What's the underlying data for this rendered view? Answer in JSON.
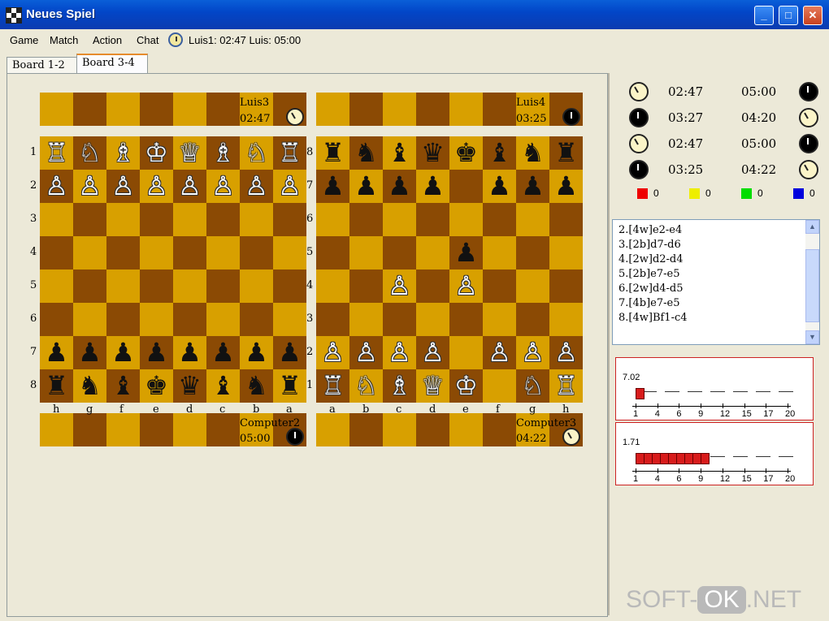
{
  "window": {
    "title": "Neues Spiel"
  },
  "menu": [
    "Game",
    "Match",
    "Action",
    "Chat"
  ],
  "status": {
    "clock_line": "Luis1: 02:47  Luis: 05:00"
  },
  "tabs": [
    "Board 1-2",
    "Board 3-4"
  ],
  "left_board": {
    "top_player": {
      "name": "Luis3",
      "time": "02:47"
    },
    "bottom_player": {
      "name": "Computer2",
      "time": "05:00"
    },
    "rank_labels": [
      "1",
      "2",
      "3",
      "4",
      "5",
      "6",
      "7",
      "8"
    ],
    "file_labels": [
      "h",
      "g",
      "f",
      "e",
      "d",
      "c",
      "b",
      "a"
    ],
    "rows": [
      [
        "wR",
        "wN",
        "wB",
        "wK",
        "wQ",
        "wB",
        "wN",
        "wR"
      ],
      [
        "wP",
        "wP",
        "wP",
        "wP",
        "wP",
        "wP",
        "wP",
        "wP"
      ],
      [
        "",
        "",
        "",
        "",
        "",
        "",
        "",
        ""
      ],
      [
        "",
        "",
        "",
        "",
        "",
        "",
        "",
        ""
      ],
      [
        "",
        "",
        "",
        "",
        "",
        "",
        "",
        ""
      ],
      [
        "",
        "",
        "",
        "",
        "",
        "",
        "",
        ""
      ],
      [
        "bP",
        "bP",
        "bP",
        "bP",
        "bP",
        "bP",
        "bP",
        "bP"
      ],
      [
        "bR",
        "bN",
        "bB",
        "bK",
        "bQ",
        "bB",
        "bN",
        "bR"
      ]
    ]
  },
  "right_board": {
    "top_player": {
      "name": "Luis4",
      "time": "03:25"
    },
    "bottom_player": {
      "name": "Computer3",
      "time": "04:22"
    },
    "rank_labels": [
      "8",
      "7",
      "6",
      "5",
      "4",
      "3",
      "2",
      "1"
    ],
    "file_labels": [
      "a",
      "b",
      "c",
      "d",
      "e",
      "f",
      "g",
      "h"
    ],
    "rows": [
      [
        "bR",
        "bN",
        "bB",
        "bQ",
        "bK",
        "bB",
        "bN",
        "bR"
      ],
      [
        "bP",
        "bP",
        "bP",
        "bP",
        "",
        "bP",
        "bP",
        "bP"
      ],
      [
        "",
        "",
        "",
        "",
        "",
        "",
        "",
        ""
      ],
      [
        "",
        "",
        "",
        "",
        "bP",
        "",
        "",
        ""
      ],
      [
        "",
        "",
        "wP",
        "",
        "wP",
        "",
        "",
        ""
      ],
      [
        "",
        "",
        "",
        "",
        "",
        "",
        "",
        ""
      ],
      [
        "wP",
        "wP",
        "wP",
        "wP",
        "",
        "wP",
        "wP",
        "wP"
      ],
      [
        "wR",
        "wN",
        "wB",
        "wQ",
        "wK",
        "",
        "wN",
        "wR"
      ]
    ]
  },
  "match_clocks": [
    {
      "left": "02:47",
      "right": "05:00",
      "left_icon": "white",
      "right_icon": "black"
    },
    {
      "left": "03:27",
      "right": "04:20",
      "left_icon": "black",
      "right_icon": "white"
    },
    {
      "left": "02:47",
      "right": "05:00",
      "left_icon": "white",
      "right_icon": "black"
    },
    {
      "left": "03:25",
      "right": "04:22",
      "left_icon": "black",
      "right_icon": "white"
    }
  ],
  "piece_counts": [
    {
      "color": "#ee0000",
      "count": "0"
    },
    {
      "color": "#eeee00",
      "count": "0"
    },
    {
      "color": "#00dd00",
      "count": "0"
    },
    {
      "color": "#0000dd",
      "count": "0"
    }
  ],
  "moves": [
    "2.[4w]e2-e4",
    "3.[2b]d7-d6",
    "4.[2w]d2-d4",
    "5.[2b]e7-e5",
    "6.[2w]d4-d5",
    "7.[4b]e7-e5",
    "8.[4w]Bf1-c4"
  ],
  "graph1": {
    "value_label": "7.02",
    "x_ticks": [
      "1",
      "4",
      "6",
      "9",
      "12",
      "15",
      "17",
      "20"
    ],
    "bars": [
      1.0
    ]
  },
  "graph2": {
    "value_label": "1.71",
    "x_ticks": [
      "1",
      "4",
      "6",
      "9",
      "12",
      "15",
      "17",
      "20"
    ],
    "bars": [
      1,
      1,
      1,
      1,
      1,
      1,
      1,
      1,
      1
    ]
  },
  "watermark": {
    "left": "SOFT-",
    "ok": "OK",
    "right": ".NET"
  }
}
